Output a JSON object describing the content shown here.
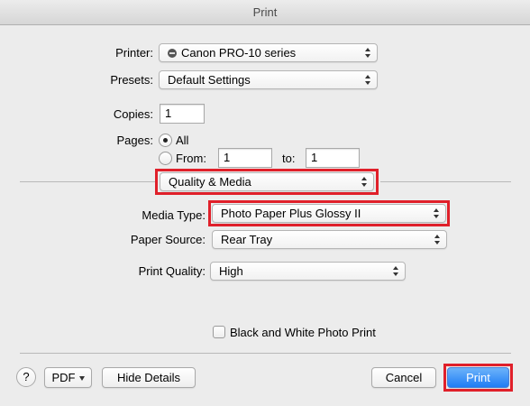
{
  "window": {
    "title": "Print"
  },
  "printer": {
    "label": "Printer:",
    "value": "Canon PRO-10 series",
    "icon": "printer-icon"
  },
  "presets": {
    "label": "Presets:",
    "value": "Default Settings"
  },
  "copies": {
    "label": "Copies:",
    "value": "1"
  },
  "pages": {
    "label": "Pages:",
    "all_label": "All",
    "from_label": "From:",
    "from_value": "1",
    "to_label": "to:",
    "to_value": "1",
    "selected": "All"
  },
  "panel_selector": {
    "value": "Quality & Media"
  },
  "media_type": {
    "label": "Media Type:",
    "value": "Photo Paper Plus Glossy II"
  },
  "paper_source": {
    "label": "Paper Source:",
    "value": "Rear Tray"
  },
  "print_quality": {
    "label": "Print Quality:",
    "value": "High"
  },
  "bw_photo": {
    "label": "Black and White Photo Print",
    "checked": false
  },
  "footer": {
    "help_label": "?",
    "pdf_label": "PDF",
    "hide_details_label": "Hide Details",
    "cancel_label": "Cancel",
    "print_label": "Print"
  },
  "colors": {
    "highlight": "#e0202a",
    "primary_button": "#1f7cf4"
  }
}
